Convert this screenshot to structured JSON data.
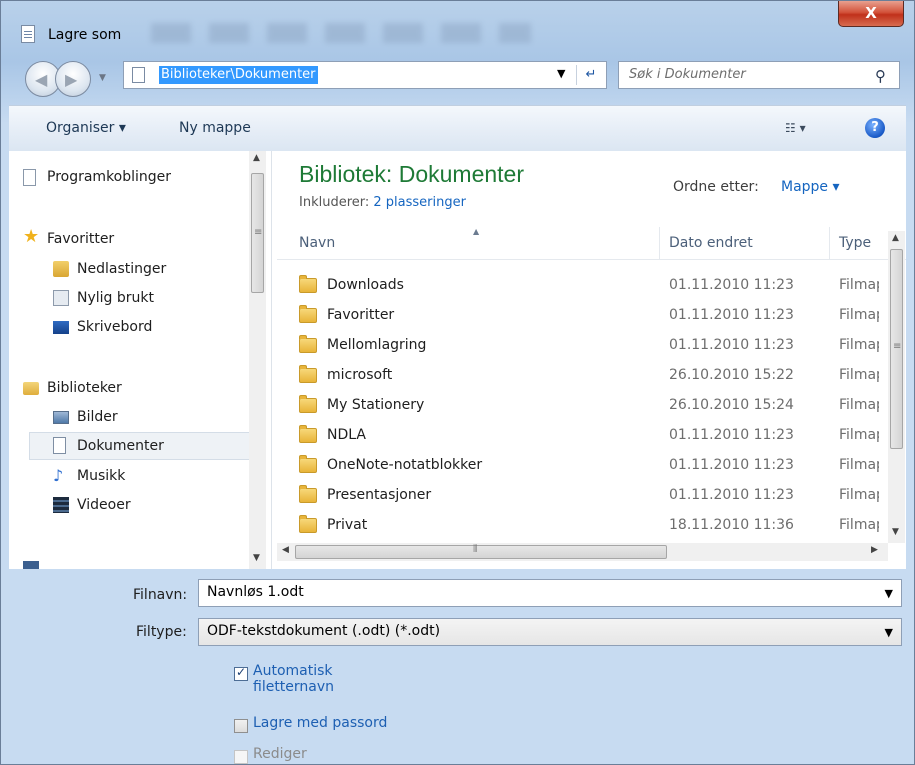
{
  "window": {
    "title": "Lagre som",
    "close_label": "X"
  },
  "address": {
    "path": "Biblioteker\\Dokumenter",
    "search_placeholder": "Søk i Dokumenter"
  },
  "toolbar": {
    "organize_label": "Organiser ▾",
    "new_folder_label": "Ny mappe"
  },
  "sidebar": {
    "items": [
      {
        "label": "Programkoblinger",
        "icon": "shortcut-icon"
      },
      {
        "label": "Favoritter",
        "icon": "star-icon"
      },
      {
        "label": "Nedlastinger",
        "icon": "downloads-icon"
      },
      {
        "label": "Nylig brukt",
        "icon": "recent-places-icon"
      },
      {
        "label": "Skrivebord",
        "icon": "desktop-icon"
      },
      {
        "label": "Biblioteker",
        "icon": "library-icon"
      },
      {
        "label": "Bilder",
        "icon": "pictures-icon"
      },
      {
        "label": "Dokumenter",
        "icon": "documents-icon",
        "selected": true
      },
      {
        "label": "Musikk",
        "icon": "music-icon"
      },
      {
        "label": "Videoer",
        "icon": "videos-icon"
      }
    ]
  },
  "library": {
    "title": "Bibliotek: Dokumenter",
    "includes_label": "Inkluderer:",
    "includes_link": "2 plasseringer",
    "arrange_label": "Ordne etter:",
    "arrange_value": "Mappe ▾"
  },
  "columns": {
    "name": "Navn",
    "date": "Dato endret",
    "type": "Type"
  },
  "files": [
    {
      "name": "Downloads",
      "date": "01.11.2010 11:23",
      "type": "Filmappe"
    },
    {
      "name": "Favoritter",
      "date": "01.11.2010 11:23",
      "type": "Filmappe"
    },
    {
      "name": "Mellomlagring",
      "date": "01.11.2010 11:23",
      "type": "Filmappe"
    },
    {
      "name": "microsoft",
      "date": "26.10.2010 15:22",
      "type": "Filmappe"
    },
    {
      "name": "My Stationery",
      "date": "26.10.2010 15:24",
      "type": "Filmappe"
    },
    {
      "name": "NDLA",
      "date": "01.11.2010 11:23",
      "type": "Filmappe"
    },
    {
      "name": "OneNote-notatblokker",
      "date": "01.11.2010 11:23",
      "type": "Filmappe"
    },
    {
      "name": "Presentasjoner",
      "date": "01.11.2010 11:23",
      "type": "Filmappe"
    },
    {
      "name": "Privat",
      "date": "18.11.2010 11:36",
      "type": "Filmappe"
    }
  ],
  "form": {
    "filename_label": "Filnavn:",
    "filename_value": "Navnløs 1.odt",
    "filetype_label": "Filtype:",
    "filetype_value": "ODF-tekstdokument (.odt) (*.odt)",
    "auto_ext_label_1": "Automatisk",
    "auto_ext_label_2": "filetternavn",
    "auto_ext_checked": true,
    "password_label": "Lagre med passord",
    "password_checked": false,
    "edit_label": "Rediger",
    "edit_enabled": false
  }
}
